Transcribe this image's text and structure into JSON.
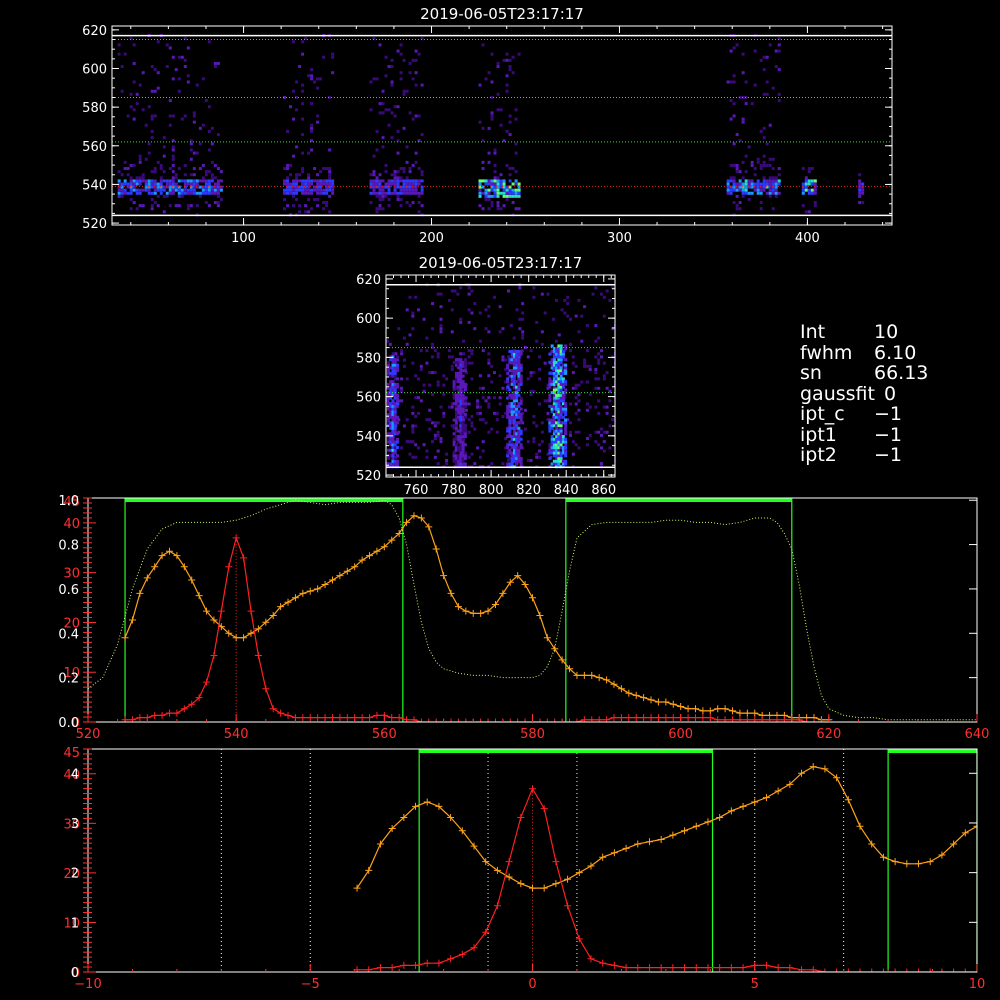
{
  "colors": {
    "axis": "#ffffff",
    "orange": "#ffa319",
    "red": "#ff2020",
    "green": "#22ff22",
    "filter_dotted": "#ccff66",
    "grid_green": "#33dd33",
    "grid_red": "#dd2222",
    "vertical_dotted": "#ffffaa",
    "red_ticks": "#ff3030"
  },
  "info_panel": [
    {
      "key": "Int",
      "value": "10"
    },
    {
      "key": "fwhm",
      "value": "6.10"
    },
    {
      "key": "sn",
      "value": "66.13"
    },
    {
      "key": "gaussfit",
      "value": "0"
    },
    {
      "key": "ipt_c",
      "value": "−1"
    },
    {
      "key": "ipt1",
      "value": "−1"
    },
    {
      "key": "ipt2",
      "value": "−1"
    }
  ],
  "chart_data": [
    {
      "id": "spectrogram-top",
      "type": "heatmap",
      "title": "2019-06-05T23:17:17",
      "xlim": [
        30,
        445
      ],
      "ylim": [
        519,
        622
      ],
      "xticks": [
        100,
        200,
        300,
        400
      ],
      "yticks": [
        520,
        540,
        560,
        580,
        600,
        620
      ],
      "hlines_white": [
        524,
        617
      ],
      "hlines_green": [
        562,
        585,
        615
      ],
      "hlines_red": [
        539
      ],
      "blocks": [
        {
          "x0": 33,
          "x1": 88,
          "y0": 525,
          "y1": 618,
          "core": [
            535,
            543
          ],
          "intensity": 0.65
        },
        {
          "x0": 121,
          "x1": 147,
          "y0": 525,
          "y1": 618,
          "core": [
            535,
            543
          ],
          "intensity": 0.55
        },
        {
          "x0": 167,
          "x1": 195,
          "y0": 525,
          "y1": 618,
          "core": [
            535,
            543
          ],
          "intensity": 0.5
        },
        {
          "x0": 225,
          "x1": 246,
          "y0": 525,
          "y1": 618,
          "core": [
            534,
            544
          ],
          "intensity": 0.95
        },
        {
          "x0": 357,
          "x1": 385,
          "y0": 525,
          "y1": 618,
          "core": [
            535,
            543
          ],
          "intensity": 0.7
        },
        {
          "x0": 397,
          "x1": 405,
          "y0": 525,
          "y1": 560,
          "core": [
            535,
            543
          ],
          "intensity": 0.8
        },
        {
          "x0": 427,
          "x1": 430,
          "y0": 525,
          "y1": 560,
          "core": [
            535,
            543
          ],
          "intensity": 0.5
        }
      ]
    },
    {
      "id": "spectrogram-mid",
      "type": "heatmap",
      "title": "2019-06-05T23:17:17",
      "xlim": [
        744,
        866
      ],
      "ylim": [
        519,
        622
      ],
      "xticks": [
        760,
        780,
        800,
        820,
        840,
        860
      ],
      "yticks": [
        520,
        540,
        560,
        580,
        600,
        620
      ],
      "hlines_white": [
        524,
        617
      ],
      "hlines_green": [
        562,
        585
      ],
      "columns": [
        {
          "x": 747,
          "width": 5,
          "y0": 525,
          "y1": 582,
          "intensity": 0.7
        },
        {
          "x": 783,
          "width": 7,
          "y0": 525,
          "y1": 580,
          "intensity": 0.45
        },
        {
          "x": 812,
          "width": 8,
          "y0": 525,
          "y1": 585,
          "intensity": 0.75
        },
        {
          "x": 835,
          "width": 9,
          "y0": 525,
          "y1": 587,
          "intensity": 0.95
        }
      ]
    },
    {
      "id": "spectrum-wavelength",
      "type": "line",
      "xlim": [
        520,
        640
      ],
      "xticks": [
        520,
        540,
        560,
        580,
        600,
        620,
        640
      ],
      "left_tick_labels": [
        "0.0",
        "0.2",
        "0.4",
        "0.6",
        "0.8",
        "1.0"
      ],
      "red_tick_labels": [
        "0",
        "10",
        "20",
        "30",
        "40"
      ],
      "ylim_norm": [
        0,
        1.01
      ],
      "green_windows": [
        [
          525,
          562.5
        ],
        [
          584.5,
          615
        ]
      ],
      "red_vline": 540,
      "series": [
        {
          "color": "orange",
          "x": [
            525,
            526,
            527,
            528,
            529,
            530,
            531,
            532,
            533,
            534,
            535,
            536,
            537,
            538,
            539,
            540,
            541,
            542,
            543,
            544,
            545,
            546,
            547,
            548,
            549,
            550,
            551,
            552,
            553,
            554,
            555,
            556,
            557,
            558,
            559,
            560,
            561,
            562,
            563,
            564,
            565,
            566,
            567,
            568,
            569,
            570,
            571,
            572,
            573,
            574,
            575,
            576,
            577,
            578,
            579,
            580,
            581,
            582,
            583,
            584,
            585,
            586,
            587,
            588,
            589,
            590,
            591,
            592,
            593,
            594,
            595,
            596,
            597,
            598,
            599,
            600,
            601,
            602,
            603,
            604,
            605,
            606,
            607,
            608,
            609,
            610,
            611,
            612,
            613,
            614,
            615,
            616,
            617,
            618,
            619,
            620
          ],
          "y": [
            0.38,
            0.46,
            0.58,
            0.65,
            0.7,
            0.75,
            0.77,
            0.75,
            0.7,
            0.64,
            0.57,
            0.5,
            0.46,
            0.43,
            0.4,
            0.38,
            0.38,
            0.4,
            0.42,
            0.45,
            0.48,
            0.52,
            0.54,
            0.56,
            0.58,
            0.59,
            0.6,
            0.62,
            0.64,
            0.66,
            0.68,
            0.7,
            0.73,
            0.75,
            0.77,
            0.79,
            0.82,
            0.85,
            0.9,
            0.93,
            0.92,
            0.88,
            0.78,
            0.66,
            0.58,
            0.52,
            0.5,
            0.49,
            0.49,
            0.5,
            0.53,
            0.58,
            0.63,
            0.66,
            0.62,
            0.56,
            0.48,
            0.38,
            0.33,
            0.28,
            0.24,
            0.21,
            0.21,
            0.21,
            0.2,
            0.19,
            0.17,
            0.15,
            0.13,
            0.12,
            0.11,
            0.1,
            0.09,
            0.09,
            0.08,
            0.07,
            0.06,
            0.06,
            0.05,
            0.05,
            0.06,
            0.06,
            0.05,
            0.04,
            0.04,
            0.04,
            0.03,
            0.03,
            0.03,
            0.03,
            0.02,
            0.02,
            0.02,
            0.02,
            0.01,
            0.01
          ]
        },
        {
          "color": "red",
          "x": [
            525,
            526,
            527,
            528,
            529,
            530,
            531,
            532,
            533,
            534,
            535,
            536,
            537,
            538,
            539,
            540,
            541,
            542,
            543,
            544,
            545,
            546,
            547,
            548,
            549,
            550,
            551,
            552,
            553,
            554,
            555,
            556,
            557,
            558,
            559,
            560,
            561,
            562,
            563,
            564,
            565,
            566,
            567,
            568,
            569,
            570,
            571,
            572,
            573,
            574,
            575,
            576,
            577,
            578,
            579,
            580,
            581,
            582,
            583,
            584,
            585,
            586,
            587,
            588,
            589,
            590,
            591,
            592,
            593,
            594,
            595,
            596,
            597,
            598,
            599,
            600,
            601,
            602,
            603,
            604,
            605,
            606,
            607,
            608,
            609,
            610,
            611,
            612,
            613,
            614,
            615,
            616,
            617,
            618,
            619,
            620
          ],
          "y": [
            0.01,
            0.01,
            0.02,
            0.02,
            0.03,
            0.03,
            0.04,
            0.04,
            0.06,
            0.08,
            0.11,
            0.18,
            0.3,
            0.5,
            0.7,
            0.83,
            0.74,
            0.5,
            0.3,
            0.15,
            0.06,
            0.04,
            0.03,
            0.02,
            0.02,
            0.02,
            0.02,
            0.02,
            0.02,
            0.02,
            0.02,
            0.02,
            0.02,
            0.02,
            0.03,
            0.03,
            0.02,
            0.02,
            0.01,
            0.01,
            0.0,
            0.0,
            0.0,
            0.0,
            0.0,
            0.0,
            0.0,
            0.0,
            0.0,
            0.0,
            0.0,
            0.0,
            0.0,
            0.0,
            0.0,
            0.0,
            0.0,
            0.0,
            0.0,
            0.0,
            0.0,
            0.0,
            0.01,
            0.01,
            0.01,
            0.01,
            0.02,
            0.02,
            0.02,
            0.02,
            0.02,
            0.02,
            0.02,
            0.02,
            0.02,
            0.02,
            0.02,
            0.02,
            0.02,
            0.02,
            0.01,
            0.01,
            0.01,
            0.01,
            0.01,
            0.01,
            0.01,
            0.01,
            0.01,
            0.01,
            0.01,
            0.01,
            0.0,
            0.0,
            0.0,
            0.0
          ]
        },
        {
          "color": "filter_dotted",
          "x": [
            520,
            522,
            524,
            526,
            528,
            530,
            532,
            534,
            536,
            538,
            540,
            542,
            544,
            546,
            548,
            550,
            552,
            554,
            556,
            558,
            560,
            561,
            562,
            563,
            564,
            565,
            566,
            567,
            568,
            570,
            572,
            574,
            576,
            578,
            580,
            581,
            582,
            583,
            584,
            585,
            586,
            588,
            590,
            592,
            594,
            596,
            598,
            600,
            602,
            604,
            606,
            608,
            610,
            612,
            613,
            614,
            615,
            616,
            617,
            618,
            619,
            620,
            622,
            624,
            626,
            628,
            630,
            632,
            634,
            636,
            638,
            640
          ],
          "y": [
            0.15,
            0.2,
            0.35,
            0.6,
            0.78,
            0.87,
            0.9,
            0.9,
            0.9,
            0.9,
            0.91,
            0.93,
            0.96,
            0.98,
            1.0,
            0.99,
            0.98,
            0.99,
            0.99,
            0.99,
            1.0,
            0.98,
            0.92,
            0.8,
            0.62,
            0.45,
            0.33,
            0.27,
            0.24,
            0.22,
            0.21,
            0.21,
            0.2,
            0.2,
            0.2,
            0.21,
            0.25,
            0.33,
            0.5,
            0.68,
            0.83,
            0.89,
            0.9,
            0.9,
            0.9,
            0.9,
            0.91,
            0.91,
            0.9,
            0.9,
            0.89,
            0.9,
            0.92,
            0.92,
            0.9,
            0.85,
            0.78,
            0.62,
            0.42,
            0.25,
            0.12,
            0.06,
            0.03,
            0.02,
            0.02,
            0.01,
            0.01,
            0.01,
            0.01,
            0.01,
            0.01,
            0.01
          ]
        }
      ]
    },
    {
      "id": "spectrum-velocity",
      "type": "line",
      "xlim": [
        -10,
        10
      ],
      "xticks": [
        -10,
        -5,
        0,
        5,
        10
      ],
      "left_tick_labels": [
        "0",
        "1",
        "2",
        "3",
        "4"
      ],
      "red_tick_labels": [
        "0",
        "10",
        "20",
        "30",
        "40"
      ],
      "ylim_norm": [
        0,
        1.01
      ],
      "green_windows": [
        [
          -2.55,
          4.05
        ],
        [
          8.0,
          10.0
        ]
      ],
      "red_vline": 0,
      "white_dotted_vlines": [
        -7,
        -5
      ],
      "yellow_dotted_vlines": [
        -1,
        1,
        5,
        7
      ],
      "series": [
        {
          "color": "orange",
          "x_from_wavelength": true,
          "wavelength_center": 540,
          "wavelength_per_unit": 3.8
        },
        {
          "color": "red",
          "x_from_wavelength": true,
          "wavelength_center": 540,
          "wavelength_per_unit": 3.8
        }
      ]
    }
  ]
}
